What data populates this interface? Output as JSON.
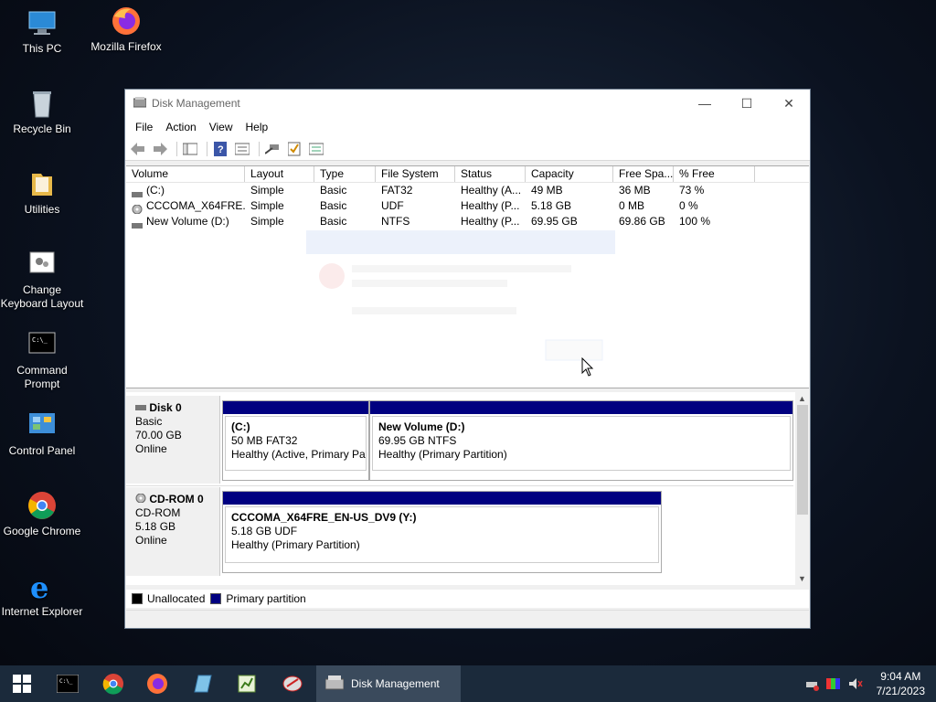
{
  "desktop": {
    "icons": [
      {
        "label": "This PC",
        "icon": "this-pc-icon"
      },
      {
        "label": "Mozilla Firefox",
        "icon": "firefox-icon"
      },
      {
        "label": "Recycle Bin",
        "icon": "recycle-bin-icon"
      },
      {
        "label": "Utilities",
        "icon": "folder-icon"
      },
      {
        "label": "Change Keyboard Layout",
        "icon": "keyboard-layout-icon"
      },
      {
        "label": "Command Prompt",
        "icon": "cmd-icon"
      },
      {
        "label": "Control Panel",
        "icon": "control-panel-icon"
      },
      {
        "label": "Google Chrome",
        "icon": "chrome-icon"
      },
      {
        "label": "Internet Explorer",
        "icon": "ie-icon"
      }
    ]
  },
  "window": {
    "title": "Disk Management",
    "menu": [
      "File",
      "Action",
      "View",
      "Help"
    ]
  },
  "volumes": {
    "columns": [
      "Volume",
      "Layout",
      "Type",
      "File System",
      "Status",
      "Capacity",
      "Free Spa...",
      "% Free"
    ],
    "rows": [
      [
        "(C:)",
        "Simple",
        "Basic",
        "FAT32",
        "Healthy (A...",
        "49 MB",
        "36 MB",
        "73 %"
      ],
      [
        "CCCOMA_X64FRE...",
        "Simple",
        "Basic",
        "UDF",
        "Healthy (P...",
        "5.18 GB",
        "0 MB",
        "0 %"
      ],
      [
        "New Volume (D:)",
        "Simple",
        "Basic",
        "NTFS",
        "Healthy (P...",
        "69.95 GB",
        "69.86 GB",
        "100 %"
      ]
    ]
  },
  "disks": {
    "disk0": {
      "name": "Disk 0",
      "type": "Basic",
      "size": "70.00 GB",
      "state": "Online",
      "partitions": [
        {
          "name": "(C:)",
          "size": "50 MB FAT32",
          "status": "Healthy (Active, Primary Pai"
        },
        {
          "name": "New Volume  (D:)",
          "size": "69.95 GB NTFS",
          "status": "Healthy (Primary Partition)"
        }
      ]
    },
    "cdrom0": {
      "name": "CD-ROM 0",
      "type": "CD-ROM",
      "size": "5.18 GB",
      "state": "Online",
      "partitions": [
        {
          "name": "CCCOMA_X64FRE_EN-US_DV9  (Y:)",
          "size": "5.18 GB UDF",
          "status": "Healthy (Primary Partition)"
        }
      ]
    }
  },
  "legend": {
    "unallocated": "Unallocated",
    "primary": "Primary partition"
  },
  "taskbar": {
    "active_label": "Disk Management",
    "time": "9:04 AM",
    "date": "7/21/2023"
  },
  "colors": {
    "primary_partition": "#000080",
    "unallocated": "#000000"
  }
}
